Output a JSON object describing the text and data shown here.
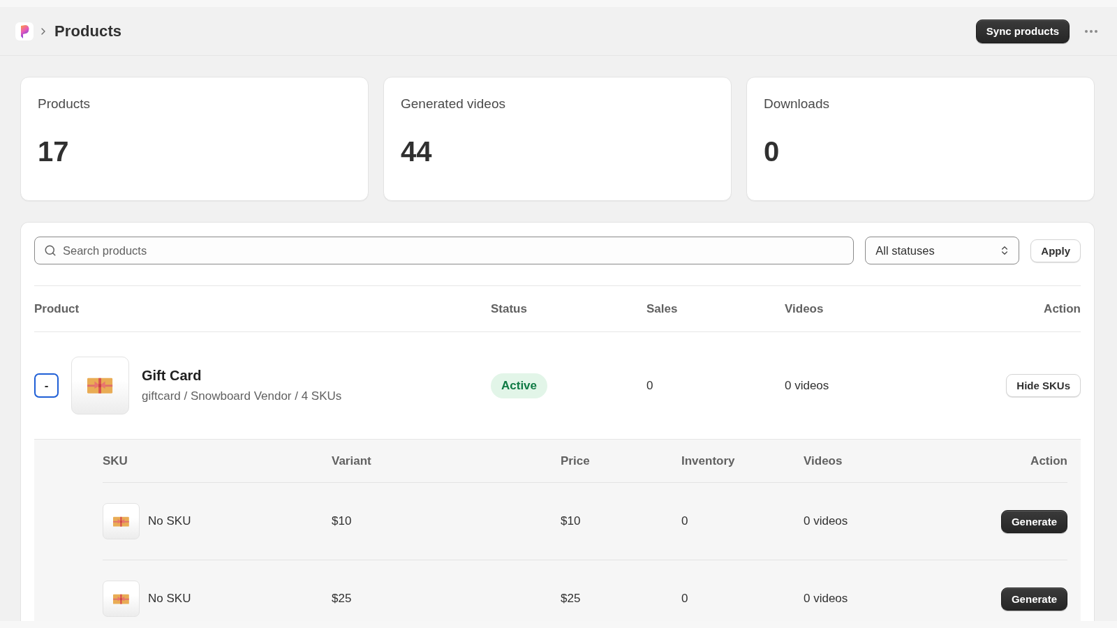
{
  "header": {
    "title": "Products",
    "primary_button": "Sync products"
  },
  "stats": [
    {
      "label": "Products",
      "value": "17"
    },
    {
      "label": "Generated videos",
      "value": "44"
    },
    {
      "label": "Downloads",
      "value": "0"
    }
  ],
  "filters": {
    "search": {
      "placeholder": "Search products"
    },
    "status_select": {
      "value": "All statuses"
    },
    "apply_button": "Apply"
  },
  "table": {
    "columns": [
      "Product",
      "Status",
      "Sales",
      "Videos",
      "Action"
    ],
    "rows": [
      {
        "toggle": {
          "label": "-",
          "focused": true
        },
        "name": "Gift Card",
        "subtitle": "giftcard / Snowboard Vendor / 4 SKUs",
        "status": {
          "label": "Active",
          "kind": "active"
        },
        "sales": "0",
        "videos": "0 videos",
        "action": "Hide SKUs",
        "skus": {
          "columns": [
            "SKU",
            "Variant",
            "Price",
            "Inventory",
            "Videos",
            "Action"
          ],
          "rows": [
            {
              "sku": "No SKU",
              "variant": "$10",
              "price": "$10",
              "inventory": "0",
              "videos": "0 videos",
              "action": "Generate"
            },
            {
              "sku": "No SKU",
              "variant": "$25",
              "price": "$25",
              "inventory": "0",
              "videos": "0 videos",
              "action": "Generate"
            }
          ]
        }
      }
    ]
  }
}
